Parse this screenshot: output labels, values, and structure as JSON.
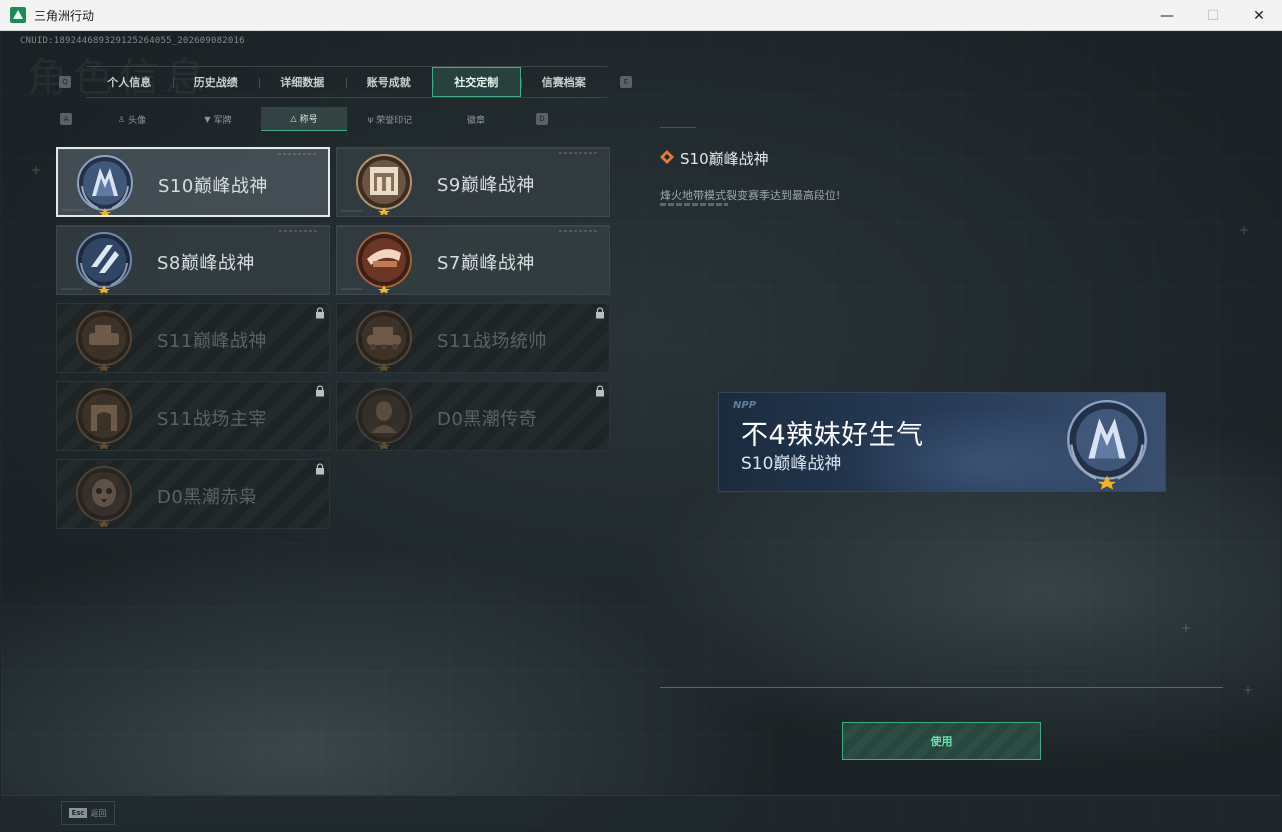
{
  "window": {
    "title": "三角洲行动",
    "minimize": "—",
    "maximize": "☐",
    "close": "✕"
  },
  "header": {
    "cnuid": "CNUID:1892446893291252640​55_202609082016",
    "page_watermark": "角色信息"
  },
  "main_tabs": {
    "left_key": "Q",
    "right_key": "E",
    "items": [
      {
        "label": "个人信息"
      },
      {
        "label": "历史战绩"
      },
      {
        "label": "详细数据"
      },
      {
        "label": "账号成就"
      },
      {
        "label": "社交定制"
      },
      {
        "label": "信赛档案"
      }
    ],
    "active_index": 4
  },
  "sub_tabs": {
    "left_key": "A",
    "right_key": "D",
    "items": [
      {
        "label": "头像",
        "icon": "person-icon"
      },
      {
        "label": "军牌",
        "icon": "dogtag-icon"
      },
      {
        "label": "称号",
        "icon": "triangle-icon"
      },
      {
        "label": "荣誉印记",
        "icon": "honor-icon"
      },
      {
        "label": "徽章",
        "icon": "badge-icon"
      }
    ],
    "active_index": 2
  },
  "titles": [
    {
      "label": "S10巅峰战神",
      "locked": false,
      "selected": true,
      "badge": "s10-peak-badge",
      "color": "#8ea3c4"
    },
    {
      "label": "S9巅峰战神",
      "locked": false,
      "selected": false,
      "badge": "s9-peak-badge",
      "color": "#b39370"
    },
    {
      "label": "S8巅峰战神",
      "locked": false,
      "selected": false,
      "badge": "s8-peak-badge",
      "color": "#6e88ae"
    },
    {
      "label": "S7巅峰战神",
      "locked": false,
      "selected": false,
      "badge": "s7-peak-badge",
      "color": "#a5603a"
    },
    {
      "label": "S11巅峰战神",
      "locked": true,
      "selected": false,
      "badge": "s11-peak-badge",
      "color": "#7a5a3c"
    },
    {
      "label": "S11战场统帅",
      "locked": true,
      "selected": false,
      "badge": "s11-commander-badge",
      "color": "#7a5a3c"
    },
    {
      "label": "S11战场主宰",
      "locked": true,
      "selected": false,
      "badge": "s11-dominator-badge",
      "color": "#7a5a3c"
    },
    {
      "label": "D0黑潮传奇",
      "locked": true,
      "selected": false,
      "badge": "d0-legend-badge",
      "color": "#5e4a3a"
    },
    {
      "label": "D0黑潮赤枭",
      "locked": true,
      "selected": false,
      "badge": "d0-owl-badge",
      "color": "#6a5240"
    }
  ],
  "detail": {
    "title": "S10巅峰战神",
    "description": "烽火地带模式裂变赛季达到最高段位!",
    "icon": "diamond-rank-icon"
  },
  "banner": {
    "logo": "NPP",
    "player_name": "不4辣妹好生气",
    "title": "S10巅峰战神",
    "badge": "s10-peak-badge"
  },
  "actions": {
    "use_label": "使用",
    "back_key": "Esc",
    "back_label": "返回"
  },
  "colors": {
    "accent": "#3fae84",
    "accent_text": "#6fe0ad",
    "star": "#f0b429"
  }
}
